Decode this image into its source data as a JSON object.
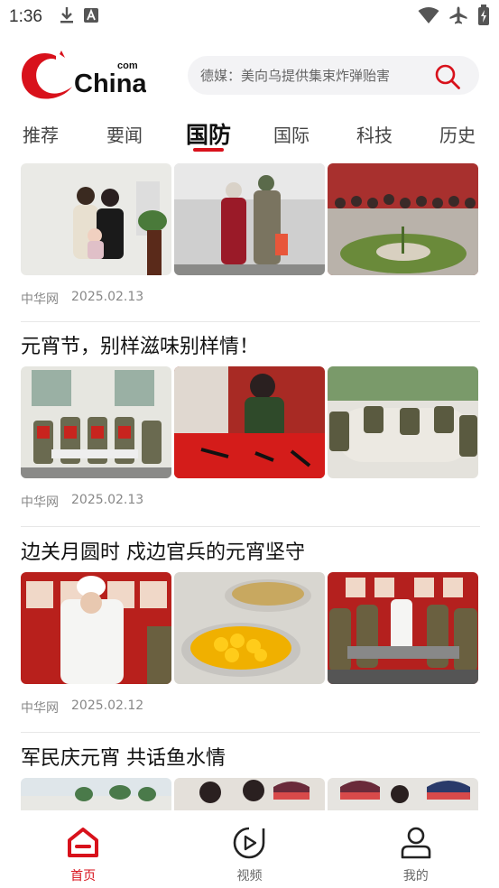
{
  "status_bar": {
    "time": "1:36",
    "left_icons": [
      "download-icon",
      "font-a-icon"
    ],
    "right_icons": [
      "wifi-icon",
      "airplane-icon",
      "battery-icon"
    ]
  },
  "header": {
    "logo_text": "China",
    "logo_com": "com",
    "search_placeholder": "德媒：美向乌提供集束炸弹贻害",
    "accent_color": "#d8111b"
  },
  "tabs": [
    {
      "label": "推荐",
      "active": false
    },
    {
      "label": "要闻",
      "active": false
    },
    {
      "label": "国防",
      "active": true
    },
    {
      "label": "国际",
      "active": false
    },
    {
      "label": "科技",
      "active": false
    },
    {
      "label": "历史",
      "active": false
    }
  ],
  "articles": [
    {
      "title": "",
      "source": "中华网",
      "date": "2025.02.13"
    },
    {
      "title": "元宵节，别样滋味别样情！",
      "source": "中华网",
      "date": "2025.02.13"
    },
    {
      "title": "边关月圆时 戍边官兵的元宵坚守",
      "source": "中华网",
      "date": "2025.02.12"
    },
    {
      "title": "军民庆元宵 共话鱼水情",
      "source": "",
      "date": ""
    }
  ],
  "bottom_nav": [
    {
      "label": "首页",
      "icon": "home-icon",
      "active": true
    },
    {
      "label": "视频",
      "icon": "video-play-icon",
      "active": false
    },
    {
      "label": "我的",
      "icon": "profile-icon",
      "active": false
    }
  ]
}
